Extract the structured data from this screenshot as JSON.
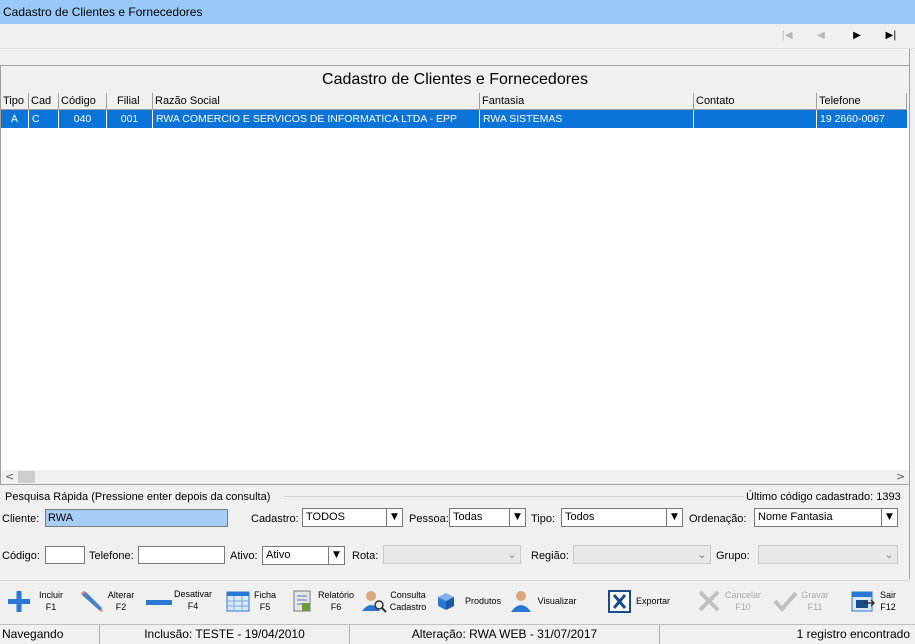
{
  "window": {
    "title": "Cadastro de Clientes e Fornecedores"
  },
  "nav": {
    "first": "|◀",
    "prev": "◀",
    "next": "▶",
    "last": "▶|"
  },
  "grid": {
    "title": "Cadastro de Clientes e Fornecedores",
    "columns": [
      "Tipo",
      "Cad",
      "Código",
      "Filial",
      "Razão Social",
      "Fantasia",
      "Contato",
      "Telefone"
    ],
    "rows": [
      {
        "tipo": "A",
        "cad": "C",
        "codigo": "040",
        "filial": "001",
        "razao": "RWA COMERCIO E SERVICOS DE INFORMATICA LTDA - EPP",
        "fantasia": "RWA SISTEMAS",
        "contato": "",
        "telefone": "19 2660-0067"
      }
    ]
  },
  "search": {
    "group_label": "Pesquisa Rápida (Pressione enter depois da consulta)",
    "last_code_label": "Último código cadastrado: 1393",
    "cliente_label": "Cliente:",
    "cliente_value": "RWA",
    "cadastro_label": "Cadastro:",
    "cadastro_value": "TODOS",
    "pessoa_label": "Pessoa:",
    "pessoa_value": "Todas",
    "tipo_label": "Tipo:",
    "tipo_value": "Todos",
    "ordenacao_label": "Ordenação:",
    "ordenacao_value": "Nome Fantasia",
    "codigo_label": "Código:",
    "codigo_value": "",
    "telefone_label": "Telefone:",
    "telefone_value": "",
    "ativo_label": "Ativo:",
    "ativo_value": "Ativo",
    "rota_label": "Rota:",
    "regiao_label": "Região:",
    "grupo_label": "Grupo:"
  },
  "toolbar": {
    "incluir": [
      "Incluir",
      "F1"
    ],
    "alterar": [
      "Alterar",
      "F2"
    ],
    "desativar": [
      "Desativar",
      "F4"
    ],
    "ficha": [
      "Ficha",
      "F5"
    ],
    "relatorio": [
      "Relatório",
      "F6"
    ],
    "consulta": [
      "Consulta",
      "Cadastro"
    ],
    "produtos": "Produtos",
    "visualizar": "Visualizar",
    "exportar": "Exportar",
    "cancelar": [
      "Cancelar",
      "F10"
    ],
    "gravar": [
      "Gravar",
      "F11"
    ],
    "sair": [
      "Sair",
      "F12"
    ]
  },
  "status": {
    "mode": "Navegando",
    "inclusao": "Inclusão: TESTE - 19/04/2010",
    "alteracao": "Alteração: RWA WEB - 31/07/2017",
    "count": "1 registro encontrado"
  },
  "colors": {
    "titlebar": "#99c9f8",
    "selection": "#0a74d9",
    "field_selected": "#a8cdf8"
  }
}
